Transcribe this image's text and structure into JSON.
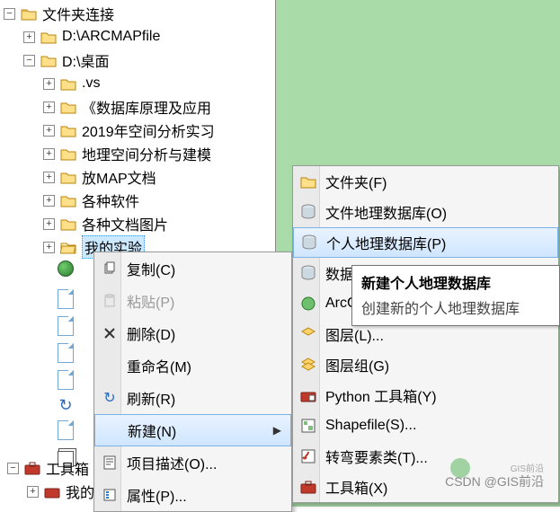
{
  "tree": {
    "root_label": "文件夹连接",
    "item_arcmap": "D:\\ARCMAPfile",
    "item_desktop": "D:\\桌面",
    "item_vs": ".vs",
    "item_db_theory": "《数据库原理及应用",
    "item_2019": "2019年空间分析实习",
    "item_geo_model": "地理空间分析与建模",
    "item_map_docs": "放MAP文档",
    "item_software": "各种软件",
    "item_docs_pics": "各种文档图片",
    "item_my_exp": "我的实验",
    "toolbox": "工具箱",
    "my": "我的"
  },
  "context1": {
    "copy": "复制(C)",
    "paste": "粘贴(P)",
    "delete": "删除(D)",
    "rename": "重命名(M)",
    "refresh": "刷新(R)",
    "new": "新建(N)",
    "item_desc": "项目描述(O)...",
    "properties": "属性(P)..."
  },
  "context2": {
    "folder": "文件夹(F)",
    "file_gdb": "文件地理数据库(O)",
    "personal_gdb": "个人地理数据库(P)",
    "database": "数据库",
    "arcgis": "ArcG",
    "layer": "图层(L)...",
    "layer_group": "图层组(G)",
    "py_toolbox": "Python 工具箱(Y)",
    "shapefile": "Shapefile(S)...",
    "turn_feature": "转弯要素类(T)...",
    "toolbox": "工具箱(X)"
  },
  "tooltip": {
    "title": "新建个人地理数据库",
    "body": "创建新的个人地理数据库"
  },
  "watermark": {
    "main": "CSDN @GIS前沿",
    "sub": "GIS前沿"
  },
  "glyph": {
    "plus": "+",
    "minus": "−",
    "arrow": "▶"
  }
}
